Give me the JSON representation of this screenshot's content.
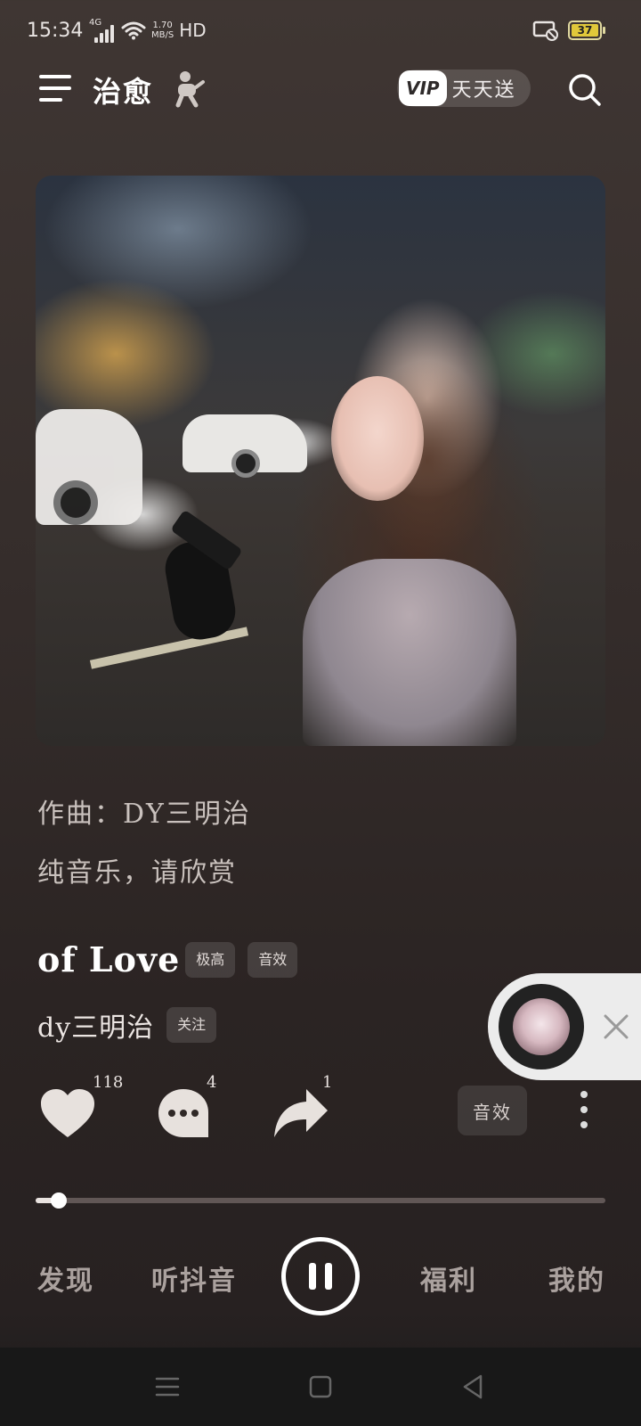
{
  "status_bar": {
    "time": "15:34",
    "network": "4G",
    "speed_value": "1.70",
    "speed_unit": "MB/S",
    "hd": "HD",
    "battery": "37",
    "battery_color": "#e0c83a"
  },
  "header": {
    "title": "治愈",
    "vip_badge": "VIP",
    "vip_text": "天天送"
  },
  "description": {
    "composer": "作曲：DY三明治",
    "note": "纯音乐，请欣赏"
  },
  "song": {
    "title": "of Love",
    "tags": [
      "极高",
      "音效"
    ],
    "artist": "dy三明治",
    "follow_label": "关注"
  },
  "actions": {
    "like_count": "118",
    "comment_count": "4",
    "share_count": "1",
    "effects_label": "音效",
    "icons": [
      "heart-icon",
      "comment-icon",
      "share-icon",
      "more-icon"
    ]
  },
  "progress": {
    "fraction": 0.04
  },
  "bottom_nav": {
    "items": [
      "发现",
      "听抖音",
      "福利",
      "我的"
    ]
  },
  "colors": {
    "background": "#352d2b",
    "accent": "#ffffff",
    "text_muted": "#c9c1bd"
  }
}
